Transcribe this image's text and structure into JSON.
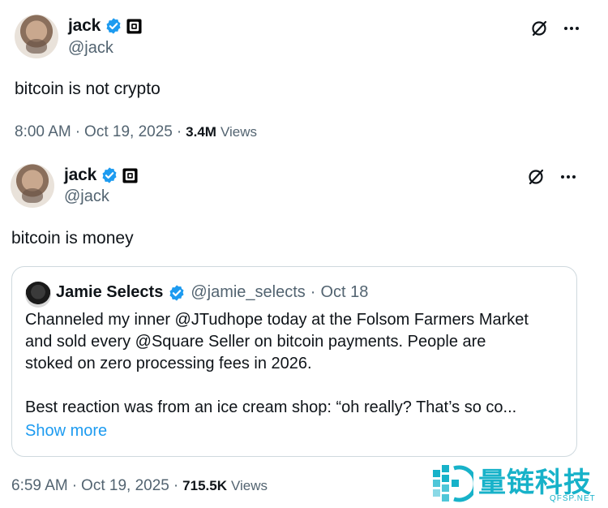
{
  "tweet1": {
    "name": "jack",
    "handle": "@jack",
    "text": "bitcoin is not crypto",
    "time": "8:00 AM",
    "date": "Oct 19, 2025",
    "views_count": "3.4M",
    "views_label": "Views"
  },
  "tweet2": {
    "name": "jack",
    "handle": "@jack",
    "text": "bitcoin is money",
    "time": "6:59 AM",
    "date": "Oct 19, 2025",
    "views_count": "715.5K",
    "views_label": "Views"
  },
  "quote": {
    "name": "Jamie Selects",
    "handle": "@jamie_selects",
    "separator": "·",
    "date": "Oct 18",
    "line1": "Channeled my inner @JTudhope today at the Folsom Farmers Market",
    "line2": "and sold every @Square Seller on bitcoin payments. People are",
    "line3": "stoked on zero processing fees in 2026.",
    "line4": "Best reaction was from an ice cream shop: “oh really? That’s so co...",
    "show_more": "Show more"
  },
  "separator": "·",
  "watermark": {
    "text": "量链科技",
    "sub": "QFSP.NET"
  },
  "colors": {
    "verified": "#1d9bf0",
    "link": "#1d9bf0",
    "secondary_text": "#536471",
    "watermark": "#17b2c9"
  },
  "icons": [
    "verified-badge-icon",
    "square-affiliate-icon",
    "grok-icon",
    "more-icon"
  ]
}
